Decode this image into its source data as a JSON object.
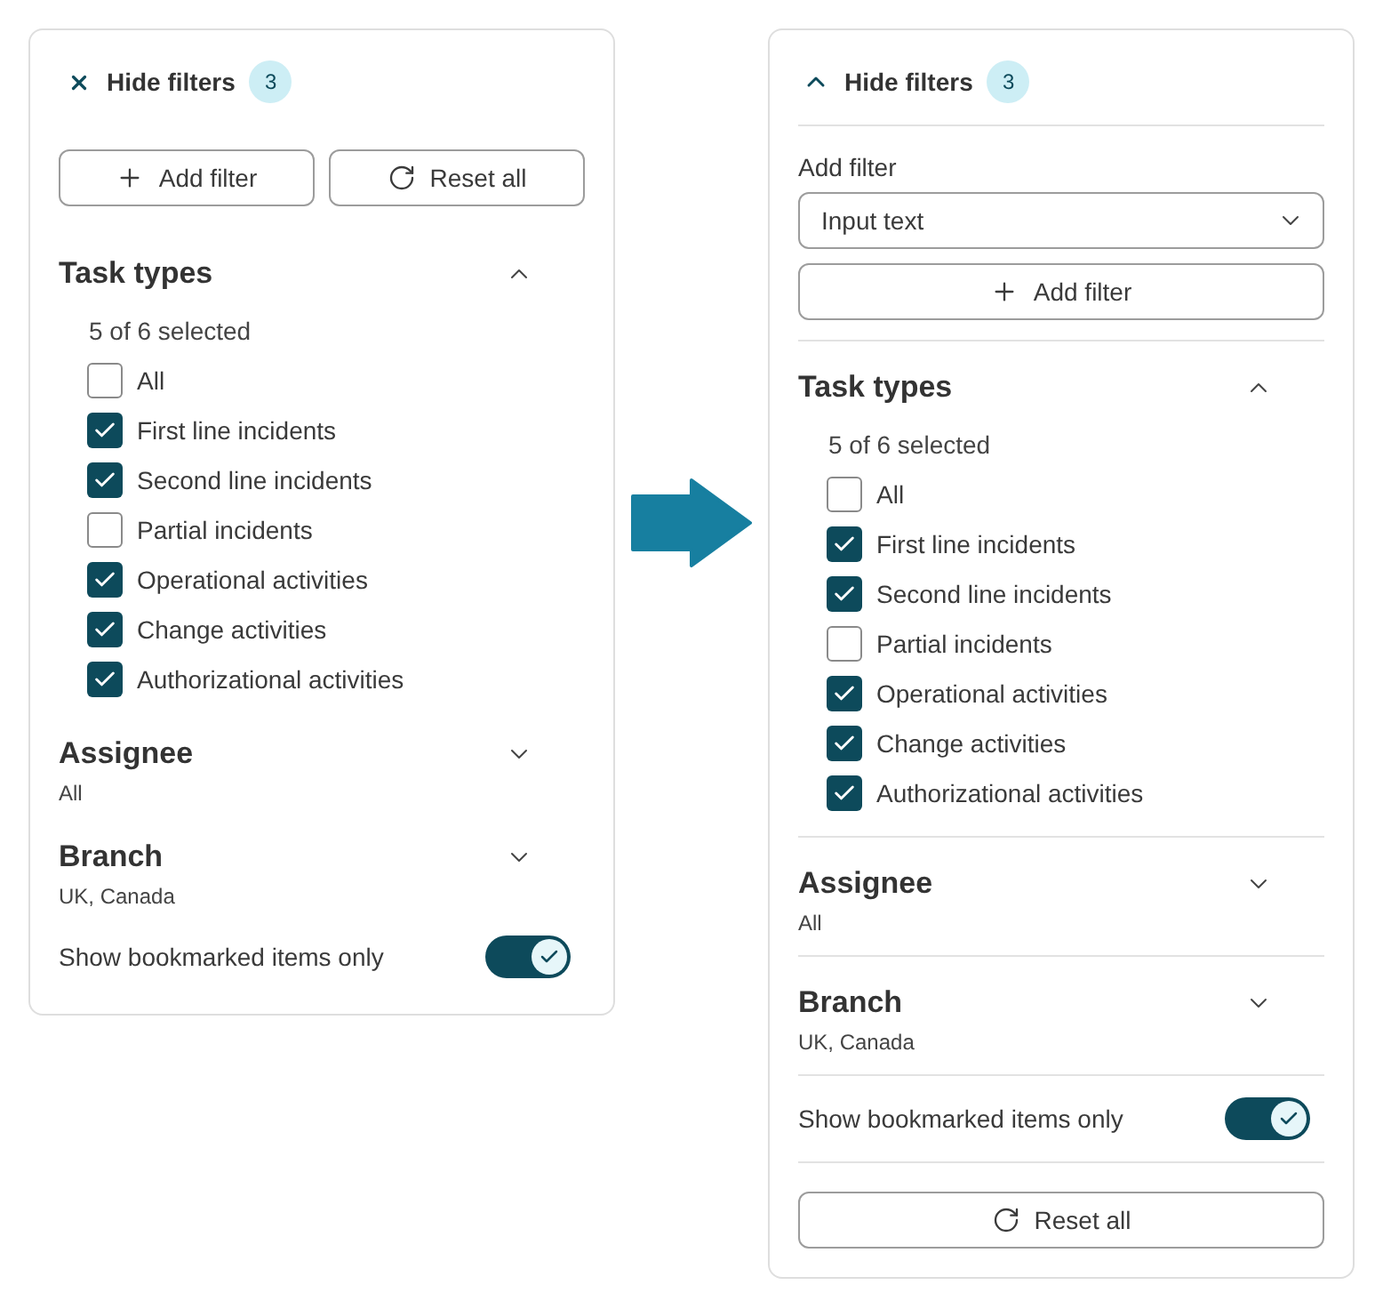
{
  "panels": [
    {
      "kind": "inline",
      "header": {
        "label": "Hide filters",
        "badge": "3"
      },
      "actions": [
        {
          "kind": "add",
          "label": "Add filter"
        },
        {
          "kind": "reset",
          "label": "Reset all"
        }
      ],
      "sections": [
        {
          "title": "Task types",
          "expanded": true,
          "summary": "5 of 6 selected",
          "options": [
            {
              "label": "All",
              "checked": false
            },
            {
              "label": "First line incidents",
              "checked": true
            },
            {
              "label": "Second line incidents",
              "checked": true
            },
            {
              "label": "Partial incidents",
              "checked": false
            },
            {
              "label": "Operational activities",
              "checked": true
            },
            {
              "label": "Change activities",
              "checked": true
            },
            {
              "label": "Authorizational activities",
              "checked": true
            }
          ]
        },
        {
          "title": "Assignee",
          "expanded": false,
          "value": "All"
        },
        {
          "title": "Branch",
          "expanded": false,
          "value": "UK, Canada"
        }
      ],
      "toggle": {
        "label": "Show bookmarked items only",
        "on": true
      }
    },
    {
      "kind": "stacked",
      "header": {
        "label": "Hide filters",
        "badge": "3"
      },
      "add_filter": {
        "label": "Add filter",
        "select": {
          "value": "Input text"
        },
        "button": {
          "kind": "add",
          "label": "Add filter"
        }
      },
      "sections": [
        {
          "title": "Task types",
          "expanded": true,
          "summary": "5 of 6 selected",
          "options": [
            {
              "label": "All",
              "checked": false
            },
            {
              "label": "First line incidents",
              "checked": true
            },
            {
              "label": "Second line incidents",
              "checked": true
            },
            {
              "label": "Partial incidents",
              "checked": false
            },
            {
              "label": "Operational activities",
              "checked": true
            },
            {
              "label": "Change activities",
              "checked": true
            },
            {
              "label": "Authorizational activities",
              "checked": true
            }
          ]
        },
        {
          "title": "Assignee",
          "expanded": false,
          "value": "All"
        },
        {
          "title": "Branch",
          "expanded": false,
          "value": "UK, Canada"
        }
      ],
      "toggle": {
        "label": "Show bookmarked items only",
        "on": true
      },
      "actions": [
        {
          "kind": "reset",
          "label": "Reset all"
        }
      ]
    }
  ]
}
